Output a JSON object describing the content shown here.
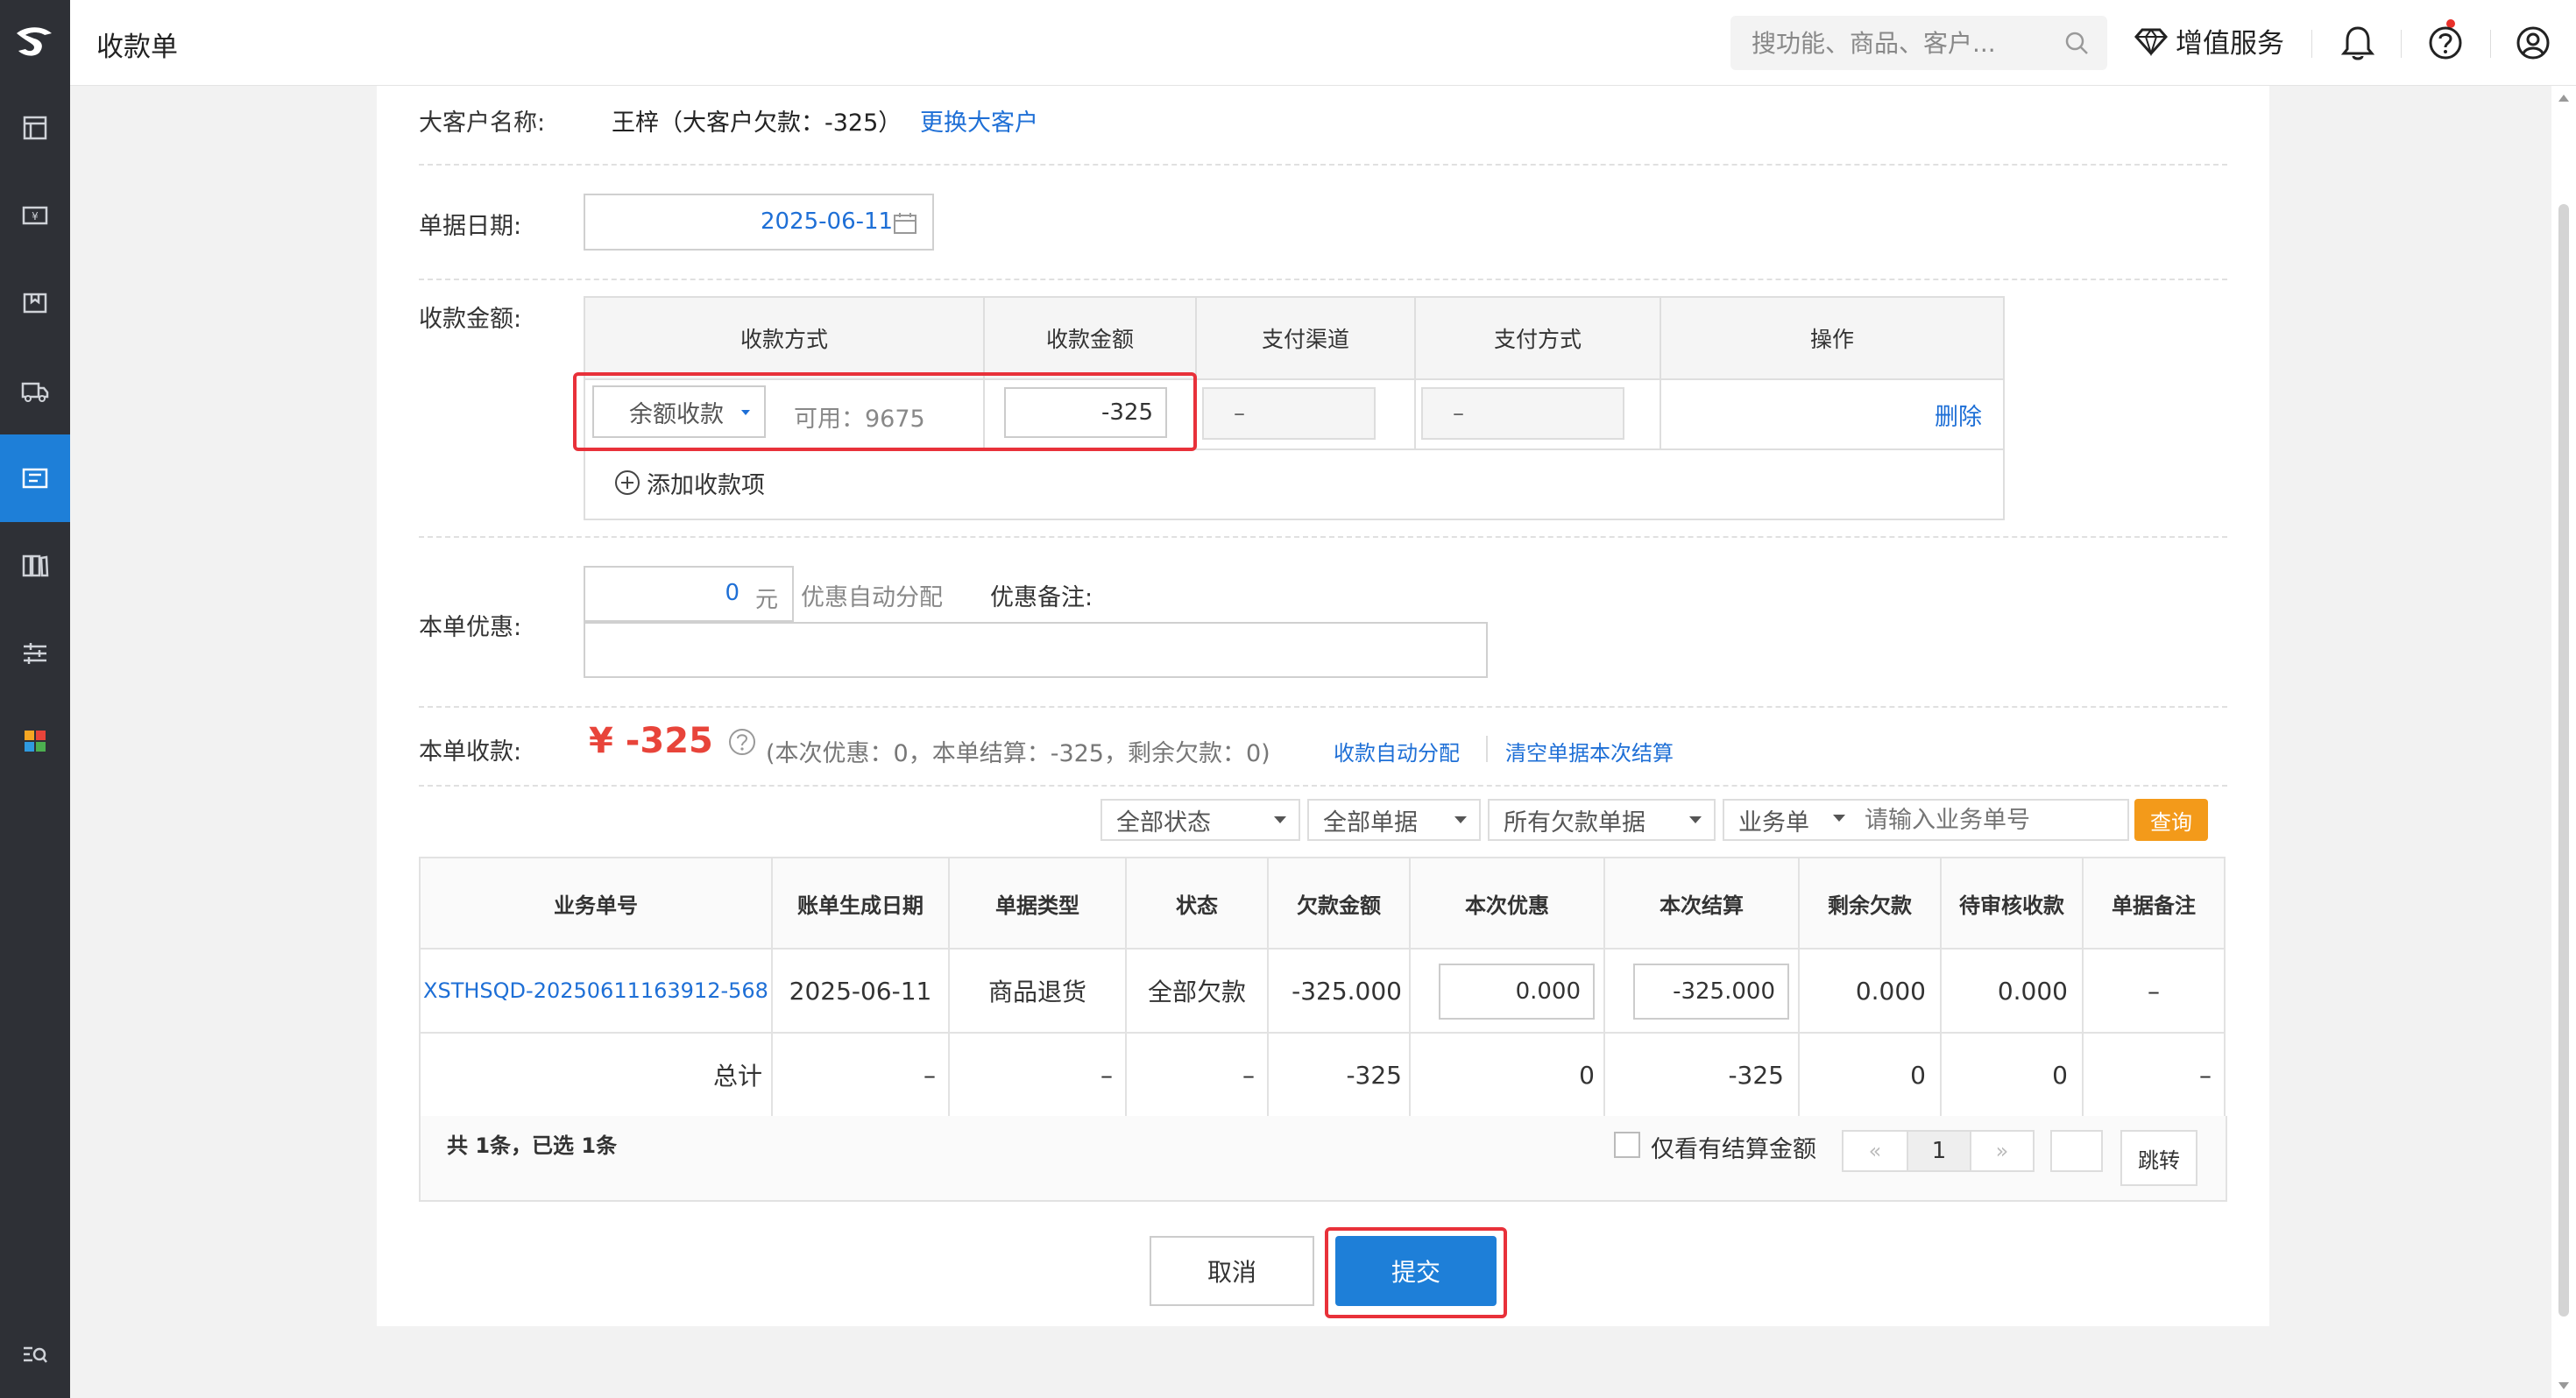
{
  "header": {
    "title": "收款单",
    "search_placeholder": "搜功能、商品、客户...",
    "vip_label": "增值服务"
  },
  "sidebar": {
    "icons": [
      "logo-icon",
      "report-icon",
      "cash-icon",
      "box-icon",
      "truck-icon",
      "receipt-icon",
      "books-icon",
      "sliders-icon",
      "apps-icon",
      "search-menu-icon"
    ],
    "active": "receipt-icon",
    "accent": "#1e7fd8"
  },
  "customer": {
    "label": "大客户名称:",
    "name": "王梓（大客户欠款：-325）",
    "change_link": "更换大客户"
  },
  "date": {
    "label": "单据日期:",
    "value": "2025-06-11"
  },
  "payment": {
    "label": "收款金额:",
    "columns": [
      "收款方式",
      "收款金额",
      "支付渠道",
      "支付方式",
      "操作"
    ],
    "row": {
      "method": "余额收款",
      "available": "可用：9675",
      "amount": "-325",
      "channel": "–",
      "pay_type": "–",
      "action": "删除"
    },
    "add_label": "添加收款项"
  },
  "discount": {
    "label": "本单优惠:",
    "value": "0",
    "unit": "元",
    "auto_label": "优惠自动分配",
    "remark_label": "优惠备注:",
    "remark_value": ""
  },
  "total": {
    "label": "本单收款:",
    "amount": "¥ -325",
    "summary": "(本次优惠：0，本单结算：-325，剩余欠款：0)",
    "auto_link": "收款自动分配",
    "clear_link": "清空单据本次结算",
    "amount_color": "#e8443a"
  },
  "filters": {
    "status": "全部状态",
    "doc": "全部单据",
    "debt": "所有欠款单据",
    "type": "业务单",
    "search_placeholder": "请输入业务单号",
    "query": "查询"
  },
  "bills": {
    "columns": [
      "业务单号",
      "账单生成日期",
      "单据类型",
      "状态",
      "欠款金额",
      "本次优惠",
      "本次结算",
      "剩余欠款",
      "待审核收款",
      "单据备注"
    ],
    "rows": [
      {
        "no": "XSTHSQD-20250611163912-568",
        "date": "2025-06-11",
        "type": "商品退货",
        "status": "全部欠款",
        "debt": "-325.000",
        "discount": "0.000",
        "settle": "-325.000",
        "remain": "0.000",
        "pending": "0.000",
        "remark": "–"
      }
    ],
    "totals": {
      "label": "总计",
      "date": "–",
      "type": "–",
      "status": "–",
      "debt": "-325",
      "discount": "0",
      "settle": "-325",
      "remain": "0",
      "pending": "0",
      "remark": "–"
    }
  },
  "pagination": {
    "summary": "共 1条，已选 1条",
    "only_settle": "仅看有结算金额",
    "prev": "«",
    "page": "1",
    "next": "»",
    "jump_value": "",
    "jump": "跳转"
  },
  "footer": {
    "cancel": "取消",
    "submit": "提交",
    "submit_color": "#1e7fd8"
  }
}
